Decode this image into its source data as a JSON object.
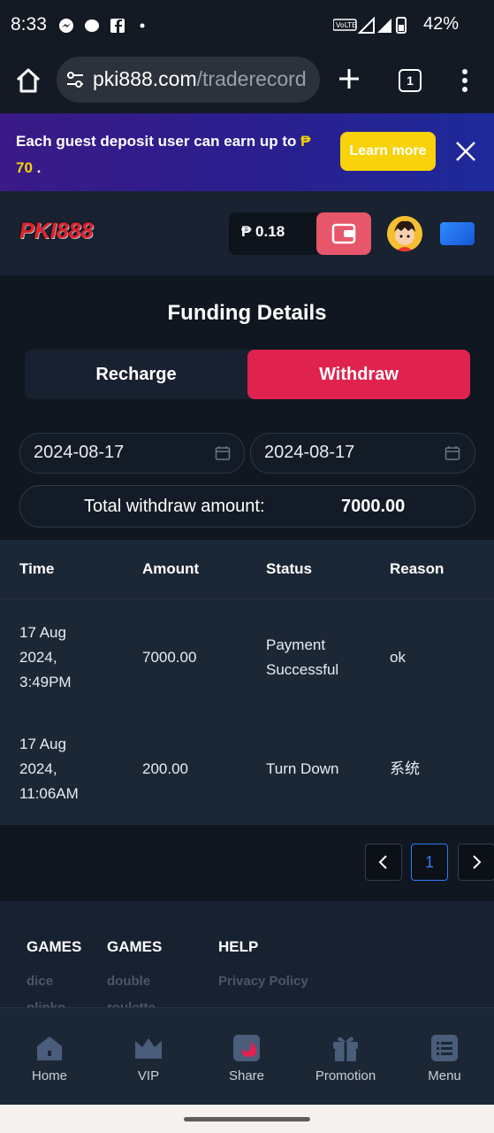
{
  "status_bar": {
    "time": "8:33",
    "battery": "42%"
  },
  "browser": {
    "url_host": "pki888.com",
    "url_path": "/traderecord",
    "tab_count": "1"
  },
  "banner": {
    "text_before": "Each guest deposit user can earn up to ",
    "currency": "₱",
    "amount": "70",
    "suffix": " .",
    "learn_more": "Learn more"
  },
  "header": {
    "logo": "PKI888",
    "balance": "₱ 0.18"
  },
  "page": {
    "title": "Funding Details",
    "tab_recharge": "Recharge",
    "tab_withdraw": "Withdraw"
  },
  "filters": {
    "start_date": "2024-08-17",
    "end_date": "2024-08-17"
  },
  "total": {
    "label": "Total withdraw amount:",
    "value": "7000.00"
  },
  "table": {
    "headers": [
      "Time",
      "Amount",
      "Status",
      "Reason"
    ],
    "rows": [
      {
        "time_lines": [
          "17 Aug",
          "2024,",
          "3:49PM"
        ],
        "amount": "7000.00",
        "status_lines": [
          "Payment",
          "Successful"
        ],
        "reason": "ok"
      },
      {
        "time_lines": [
          "17 Aug",
          "2024,",
          "11:06AM"
        ],
        "amount": "200.00",
        "status_lines": [
          "Turn Down"
        ],
        "reason": "系统"
      }
    ]
  },
  "pagination": {
    "prev": "<",
    "current": "1",
    "next": ">"
  },
  "footer": {
    "columns": [
      {
        "heading": "GAMES",
        "links": [
          "dice",
          "plinko"
        ]
      },
      {
        "heading": "GAMES",
        "links": [
          "double",
          "roulette"
        ]
      },
      {
        "heading": "HELP",
        "links": [
          "Privacy Policy"
        ]
      }
    ]
  },
  "bottom_nav": [
    {
      "label": "Home",
      "icon": "home-icon"
    },
    {
      "label": "VIP",
      "icon": "crown-icon"
    },
    {
      "label": "Share",
      "icon": "share-icon"
    },
    {
      "label": "Promotion",
      "icon": "gift-icon"
    },
    {
      "label": "Menu",
      "icon": "menu-icon"
    }
  ],
  "colors": {
    "accent": "#e0224e",
    "banner_bg": "#2a1f8f",
    "learn_more": "#f8d20a",
    "page_bg": "#101720",
    "table_bg": "#1c2736"
  }
}
